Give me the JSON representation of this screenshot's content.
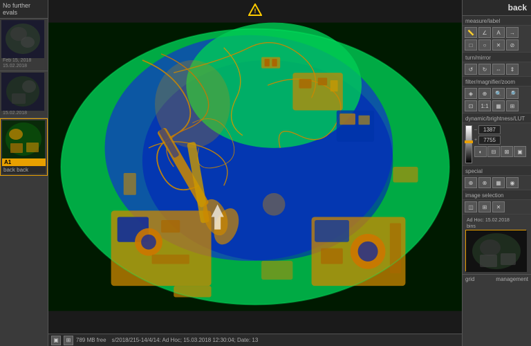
{
  "header": {
    "back_label": "back"
  },
  "left_sidebar": {
    "no_further_label": "No further evals",
    "thumbnails": [
      {
        "id": "thumb-1",
        "date": "Feb 15, 2018",
        "date2": "15.02.2018",
        "label": "",
        "active": false
      },
      {
        "id": "thumb-2",
        "date": "15.02.2018",
        "label": "",
        "active": false
      },
      {
        "id": "thumb-3",
        "date": "A1",
        "label": "back back",
        "active": true
      }
    ]
  },
  "right_panel": {
    "back_label": "back",
    "sections": [
      {
        "id": "measure-label",
        "label": "measure/label"
      },
      {
        "id": "turn-mirror",
        "label": "turn/mirror"
      },
      {
        "id": "filter-magnifier-zoom",
        "label": "filter/magnifier/zoom"
      },
      {
        "id": "dynamic-brightness-lut",
        "label": "dynamic/brightness/LUT"
      },
      {
        "id": "special",
        "label": "special"
      },
      {
        "id": "image-selection",
        "label": "image selection"
      }
    ],
    "brightness_value_1": "1387",
    "brightness_value_2": "7755",
    "bottom_date": "Ad Hoc: 15.02.2018",
    "bottom_label": "bins",
    "grid_label": "grid",
    "management_label": "management"
  },
  "bottom_bar": {
    "file_size": "789 MB free",
    "timestamp": "s/2018/215-14/4/14: Ad Hoc; 15.03.2018 12:30:04; Date: 13"
  },
  "warning": {
    "symbol": "⚠"
  }
}
